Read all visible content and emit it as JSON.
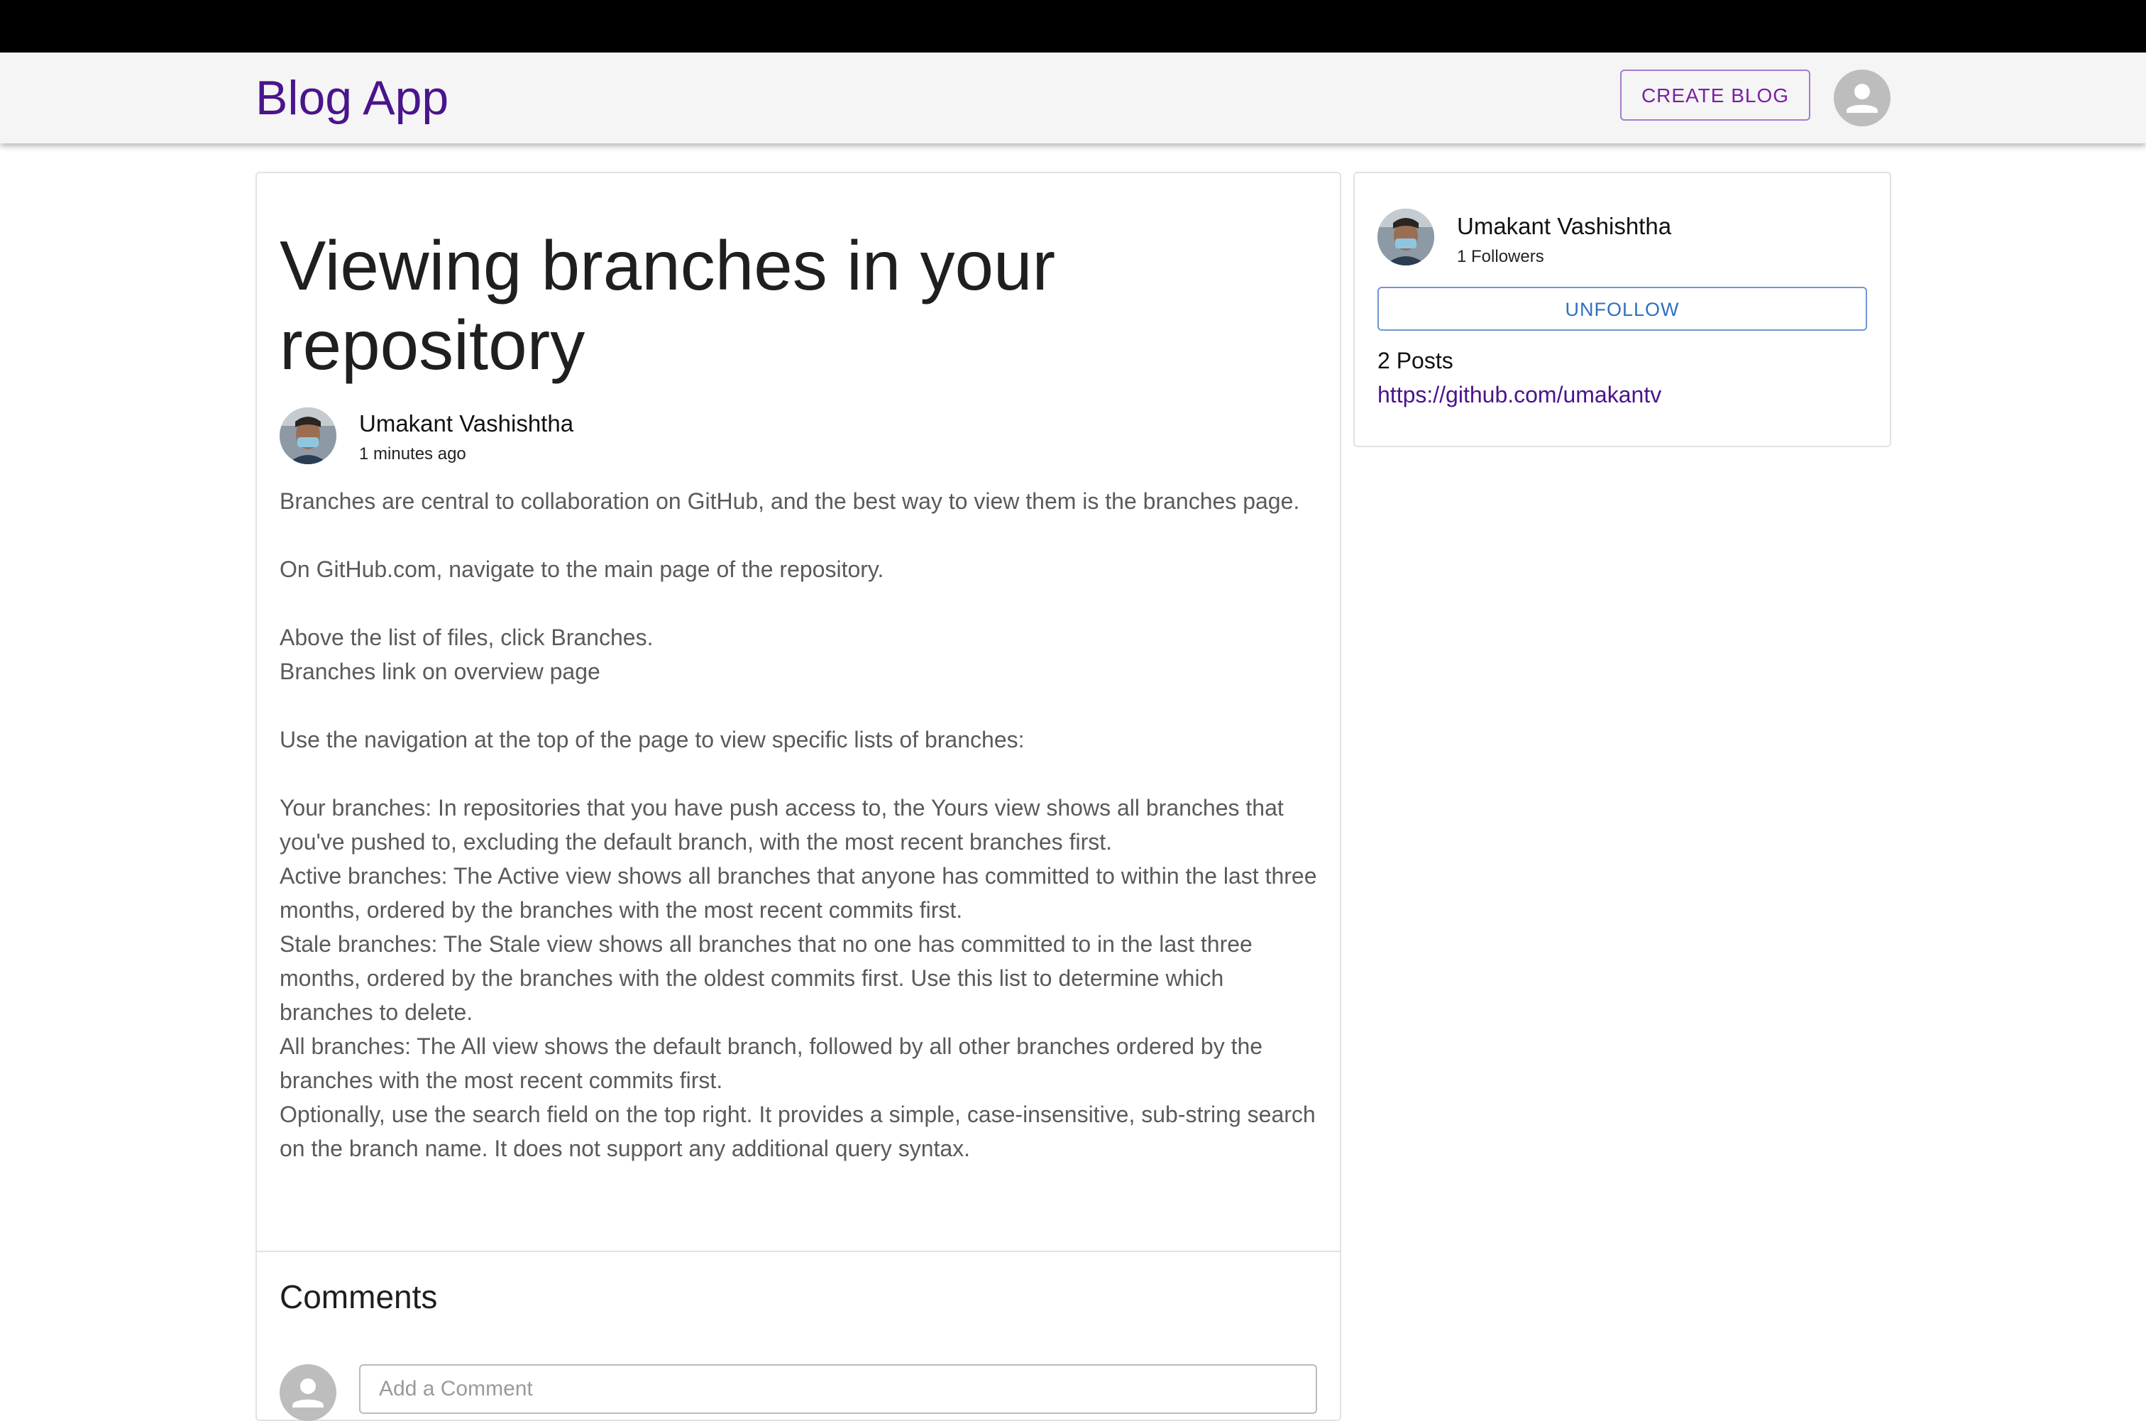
{
  "app": {
    "brand": "Blog App",
    "create_label": "CREATE BLOG"
  },
  "post": {
    "title": "Viewing branches in your repository",
    "author": "Umakant Vashishtha",
    "time": "1 minutes ago",
    "paragraphs": [
      "Branches are central to collaboration on GitHub, and the best way to view them is the branches page.",
      "",
      "On GitHub.com, navigate to the main page of the repository.",
      "",
      "Above the list of files, click  Branches.",
      "Branches link on overview page",
      "",
      "Use the navigation at the top of the page to view specific lists of branches:",
      "",
      "Your branches: In repositories that you have push access to, the Yours view shows all branches that you've pushed to, excluding the default branch, with the most recent branches first.",
      "Active branches: The Active view shows all branches that anyone has committed to within the last three months, ordered by the branches with the most recent commits first.",
      "Stale branches: The Stale view shows all branches that no one has committed to in the last three months, ordered by the branches with the oldest commits first. Use this list to determine which branches to delete.",
      "All branches: The All view shows the default branch, followed by all other branches ordered by the branches with the most recent commits first.",
      "Optionally, use the search field on the top right. It provides a simple, case-insensitive, sub-string search on the branch name. It does not support any additional query syntax."
    ]
  },
  "comments": {
    "title": "Comments",
    "placeholder": "Add a Comment"
  },
  "sidebar": {
    "author": "Umakant Vashishtha",
    "followers": "1 Followers",
    "unfollow_label": "UNFOLLOW",
    "posts": "2 Posts",
    "link": "https://github.com/umakantv"
  },
  "colors": {
    "brand": "#4a148c",
    "create_button": "#7b1fa2",
    "unfollow_button": "#2f6fc4"
  },
  "icons": {
    "user_avatar": "person-icon",
    "author_photo": "author-photo",
    "comment_avatar": "person-icon"
  }
}
